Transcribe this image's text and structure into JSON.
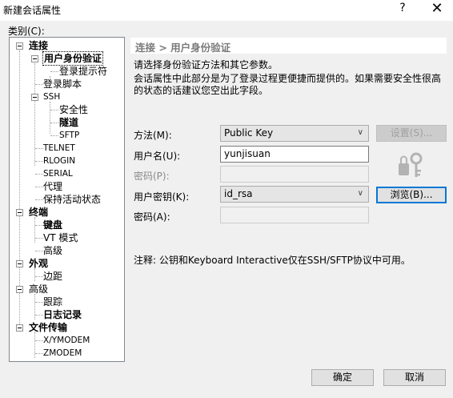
{
  "window": {
    "title": "新建会话属性",
    "help": "?",
    "close": "✕"
  },
  "category_label": "类别(C):",
  "tree": {
    "connection": "连接",
    "user_auth": "用户身份验证",
    "login_prompt": "登录提示符",
    "login_script": "登录脚本",
    "ssh": "SSH",
    "security": "安全性",
    "tunnel": "隧道",
    "sftp": "SFTP",
    "telnet": "TELNET",
    "rlogin": "RLOGIN",
    "serial": "SERIAL",
    "proxy": "代理",
    "keepalive": "保持活动状态",
    "terminal": "终端",
    "keyboard": "键盘",
    "vt_mode": "VT 模式",
    "advanced": "高级",
    "appearance": "外观",
    "margin": "边距",
    "advanced2": "高级",
    "trace": "跟踪",
    "log": "日志记录",
    "file_transfer": "文件传输",
    "xymodem": "X/YMODEM",
    "zmodem": "ZMODEM"
  },
  "breadcrumb": "连接 > 用户身份验证",
  "description": {
    "line1": "请选择身份验证方法和其它参数。",
    "line2": "会话属性中此部分是为了登录过程更便捷而提供的。如果需要安全性很高的状态的话建议您空出此字段。"
  },
  "form": {
    "method_label": "方法(M):",
    "method_value": "Public Key",
    "settings_button": "设置(S)...",
    "username_label": "用户名(U):",
    "username_value": "yunjisuan",
    "password_label": "密码(P):",
    "userkey_label": "用户密钥(K):",
    "userkey_value": "id_rsa",
    "browse_button": "浏览(B)...",
    "passphrase_label": "密码(A):"
  },
  "note": "注释: 公钥和Keyboard Interactive仅在SSH/SFTP协议中可用。",
  "footer": {
    "ok": "确定",
    "cancel": "取消"
  }
}
